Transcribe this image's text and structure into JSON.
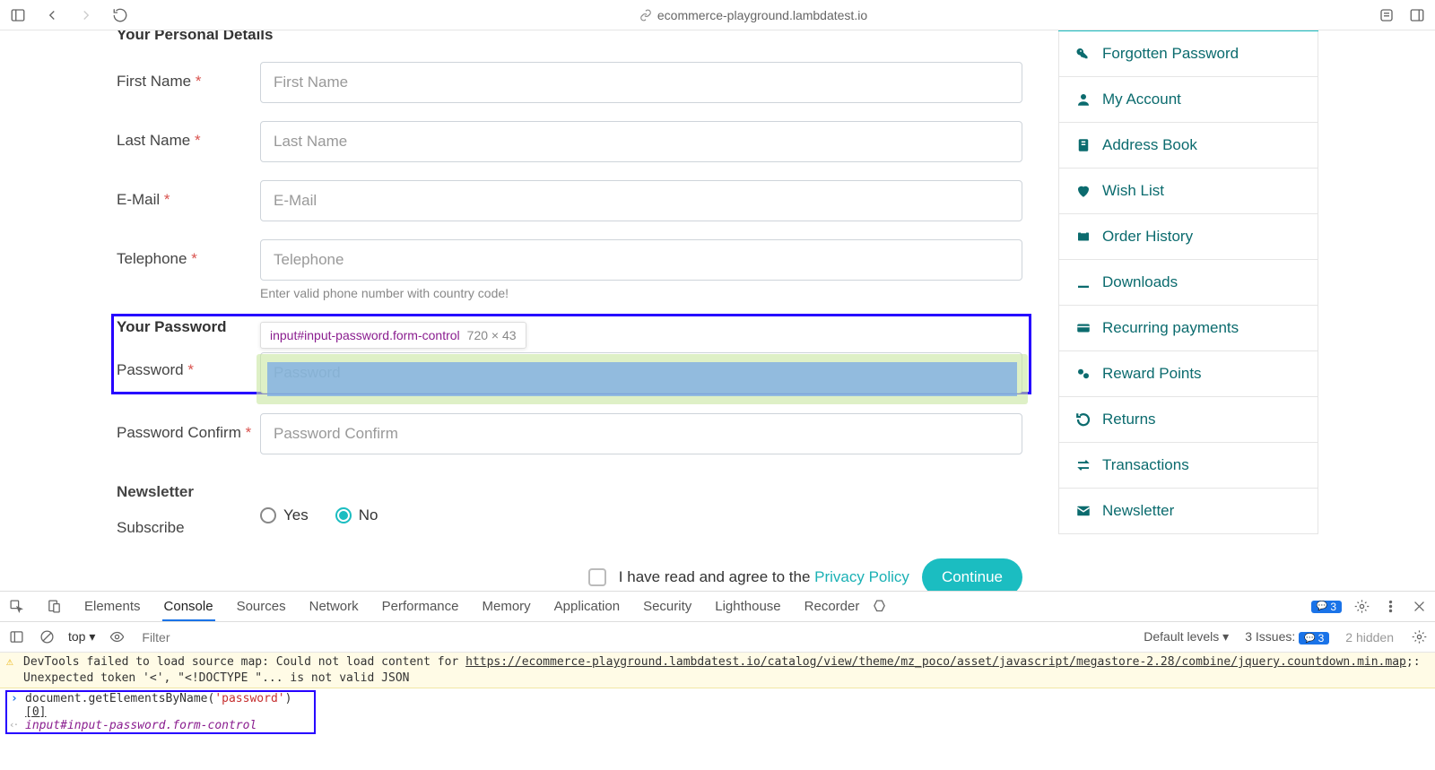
{
  "browser": {
    "url": "ecommerce-playground.lambdatest.io"
  },
  "form": {
    "section_personal": "Your Personal Details",
    "first_name": {
      "label": "First Name",
      "placeholder": "First Name"
    },
    "last_name": {
      "label": "Last Name",
      "placeholder": "Last Name"
    },
    "email": {
      "label": "E-Mail",
      "placeholder": "E-Mail"
    },
    "telephone": {
      "label": "Telephone",
      "placeholder": "Telephone",
      "help": "Enter valid phone number with country code!"
    },
    "section_password": "Your Password",
    "password": {
      "label": "Password",
      "placeholder": "Password"
    },
    "password_confirm": {
      "label": "Password Confirm",
      "placeholder": "Password Confirm"
    },
    "section_newsletter": "Newsletter",
    "subscribe_label": "Subscribe",
    "yes": "Yes",
    "no": "No",
    "agree_prefix": "I have read and agree to the ",
    "agree_link": "Privacy Policy",
    "continue": "Continue"
  },
  "inspect": {
    "selector": "input#input-password.form-control",
    "dimensions": "720 × 43"
  },
  "sidebar": {
    "items": [
      "Forgotten Password",
      "My Account",
      "Address Book",
      "Wish List",
      "Order History",
      "Downloads",
      "Recurring payments",
      "Reward Points",
      "Returns",
      "Transactions",
      "Newsletter"
    ]
  },
  "devtools": {
    "tabs": [
      "Elements",
      "Console",
      "Sources",
      "Network",
      "Performance",
      "Memory",
      "Application",
      "Security",
      "Lighthouse",
      "Recorder"
    ],
    "messages_badge": "3",
    "toolbar": {
      "context": "top",
      "filter_placeholder": "Filter",
      "levels": "Default levels",
      "issues_label": "3 Issues:",
      "issues_count": "3",
      "hidden": "2 hidden"
    },
    "console": {
      "warn_prefix": "DevTools failed to load source map: Could not load content for ",
      "warn_url": "https://ecommerce-playground.lambdatest.io/catalog/view/theme/mz_poco/asset/javascript/megastore-2.28/combine/jquery.countdown.min.map",
      "warn_suffix": ";: Unexpected token '<', \"<!DOCTYPE \"... is not valid JSON",
      "input_pre": "document.getElementsByName(",
      "input_str": "'password'",
      "input_post": ")",
      "input_idx": "[0]",
      "output": "input#input-password.form-control"
    }
  }
}
